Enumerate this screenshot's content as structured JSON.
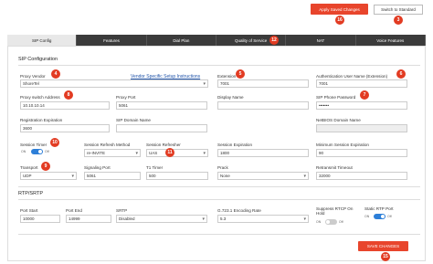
{
  "top_buttons": {
    "apply": "Apply Saved Changes",
    "switch": "Switch to Standard"
  },
  "tabs": [
    "SIP Config",
    "Features",
    "Dial Plan",
    "Quality of Service",
    "NAT",
    "Voice Features"
  ],
  "sip_section": "SIP Configuration",
  "vendor_link": "Vendor Specific Setup Instructions",
  "fields": {
    "proxy_vendor": {
      "label": "Proxy Vendor",
      "value": "ShoreTel"
    },
    "extension": {
      "label": "Extension",
      "value": "7001"
    },
    "auth_user": {
      "label": "Authentication User Name (Extension)",
      "value": "7001"
    },
    "proxy_addr": {
      "label": "Proxy switch Address",
      "value": "10.10.10.14"
    },
    "proxy_port": {
      "label": "Proxy Port",
      "value": "5061"
    },
    "display_name": {
      "label": "Display Name",
      "value": ""
    },
    "sip_password": {
      "label": "SIP Phone Password",
      "value": "•••••••"
    },
    "reg_exp": {
      "label": "Registration Expiration",
      "value": "3600"
    },
    "sip_domain": {
      "label": "SIP Domain Name",
      "value": ""
    },
    "netbios": {
      "label": "NetBIOS Domain Name",
      "value": ""
    },
    "session_timer": {
      "label": "Session Timer"
    },
    "session_refresh_method": {
      "label": "Session Refresh Method",
      "value": "re-INVITE"
    },
    "session_refresher": {
      "label": "Session Refresher",
      "value": "UAS"
    },
    "session_exp": {
      "label": "Session Expiration",
      "value": "1800"
    },
    "min_session": {
      "label": "Minimum Session Expiration",
      "value": "90"
    },
    "transport": {
      "label": "Transport",
      "value": "UDP"
    },
    "signaling_port": {
      "label": "Signaling Port",
      "value": "5061"
    },
    "t1_timer": {
      "label": "T1 Timer",
      "value": "500"
    },
    "prack": {
      "label": "Prack",
      "value": "None"
    },
    "retransmit": {
      "label": "Retransmit Timeout",
      "value": "32000"
    }
  },
  "rtp_section": "RTP/SRTP",
  "rtp": {
    "port_start": {
      "label": "Port Start",
      "value": "10000"
    },
    "port_end": {
      "label": "Port End",
      "value": "14999"
    },
    "srtp": {
      "label": "SRTP",
      "value": "Disabled"
    },
    "g7231": {
      "label": "G.723.1 Encoding Rate",
      "value": "5.3"
    },
    "suppress_rtcp": {
      "label": "Suppress RTCP On Hold"
    },
    "static_rtp": {
      "label": "Static RTP Port"
    }
  },
  "toggle_text": {
    "on": "ON",
    "off": "Off"
  },
  "save_button": "SAVE CHANGES",
  "badges": [
    "1",
    "2",
    "3",
    "4",
    "5",
    "6",
    "7",
    "8",
    "9",
    "10",
    "11",
    "12",
    "13",
    "14",
    "15",
    "16"
  ],
  "colors": {
    "accent": "#e8452c",
    "tab_dark": "#3b3b3b",
    "toggle_on": "#2d7fd8",
    "badge": "#e23b22"
  }
}
